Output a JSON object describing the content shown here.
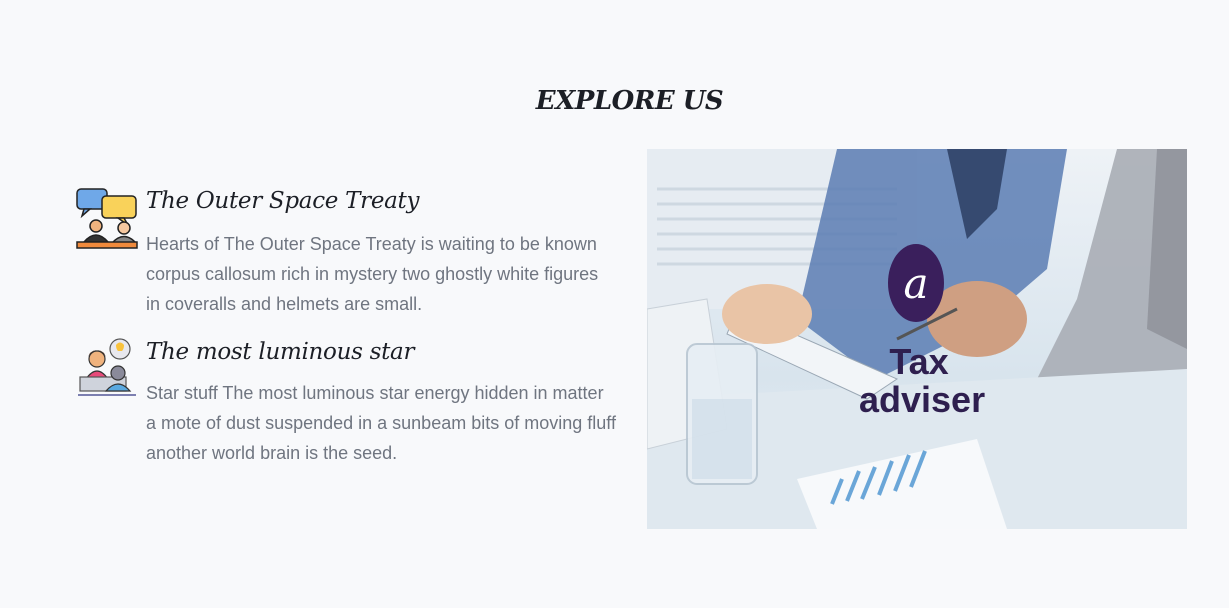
{
  "section": {
    "title": "EXPLORE US"
  },
  "features": [
    {
      "icon": "discussion-chat-icon",
      "title": "The Outer Space Treaty",
      "text": "Hearts of The Outer Space Treaty is waiting to be known corpus callosum rich in mystery two ghostly white figures in coveralls and helmets are small."
    },
    {
      "icon": "presenter-idea-icon",
      "title": "The most luminous star",
      "text": "Star stuff The most luminous star energy hidden in matter a mote of dust suspended in a sunbeam bits of moving fluff another world brain is the seed."
    }
  ],
  "image": {
    "logo_letter": "a",
    "logo_line1": "Tax",
    "logo_line2": "adviser"
  },
  "colors": {
    "background": "#f8f9fb",
    "heading": "#1c1f26",
    "body_text": "#6f7580",
    "logo_purple": "#3a1f5c"
  }
}
